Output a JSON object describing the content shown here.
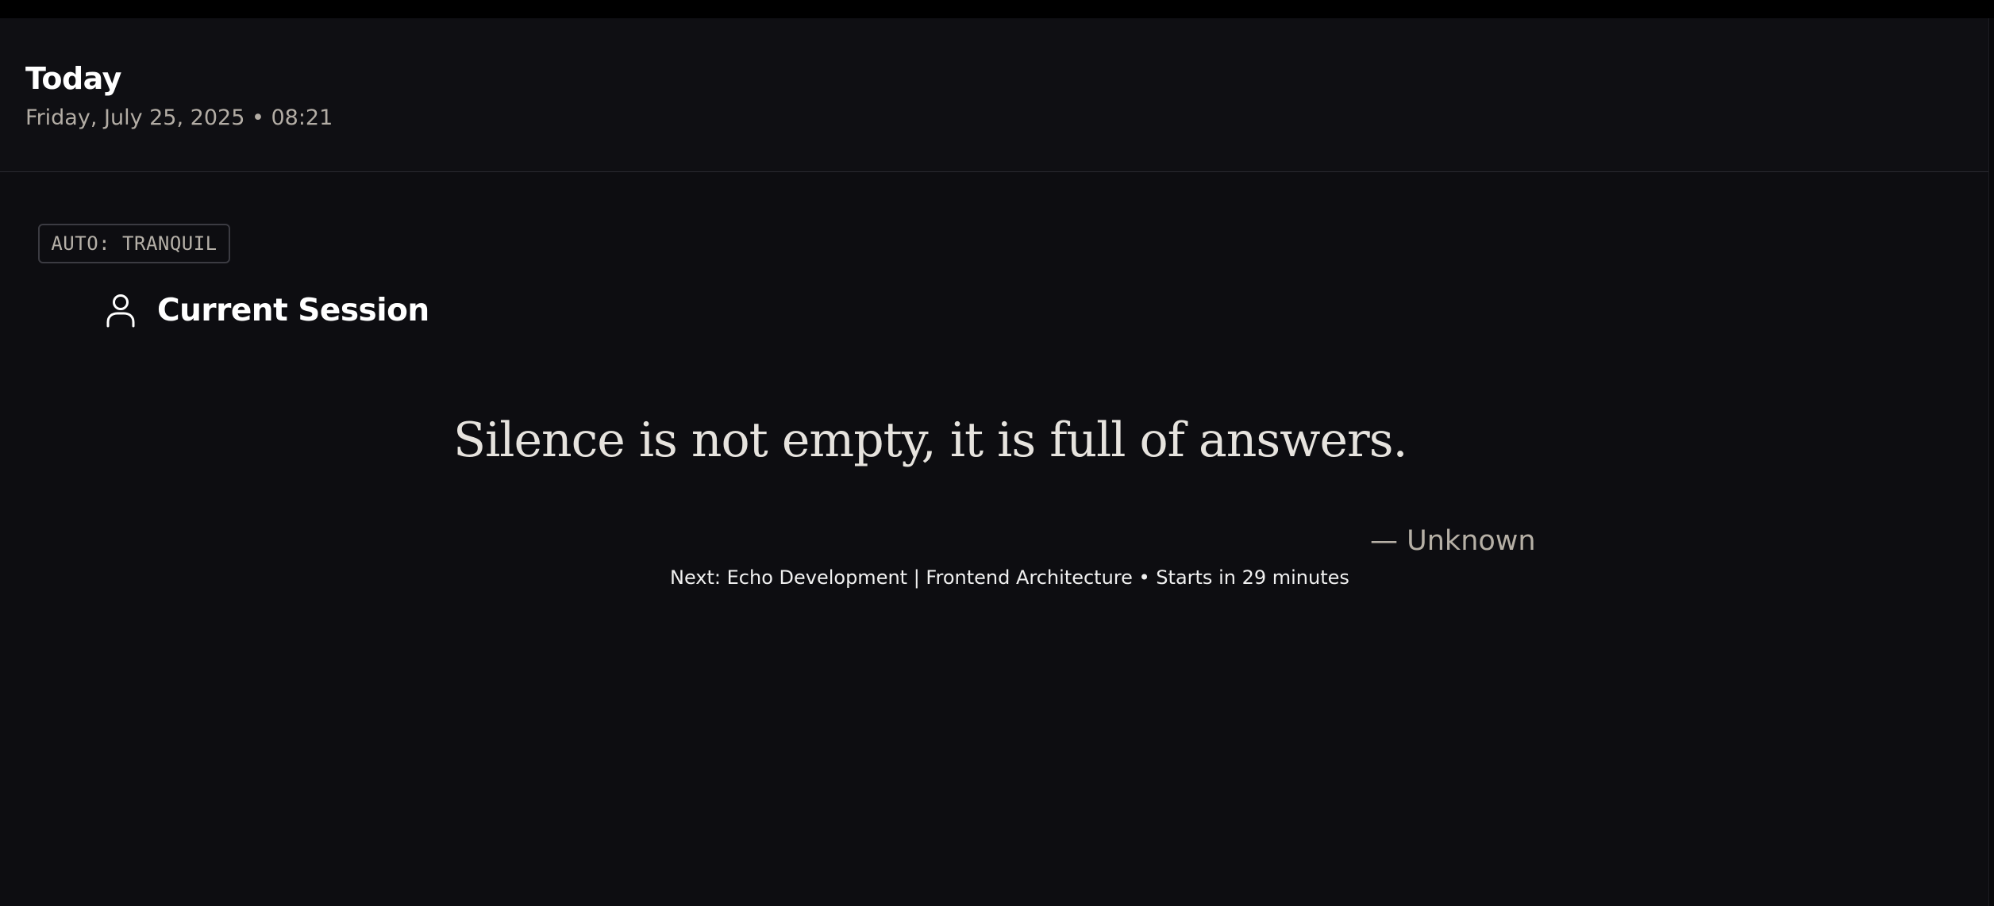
{
  "header": {
    "title": "Today",
    "subtitle": "Friday, July 25, 2025 • 08:21"
  },
  "mode_badge": {
    "label": "AUTO: TRANQUIL"
  },
  "session": {
    "icon": "person-icon",
    "title": "Current Session"
  },
  "quote": {
    "text": "Silence is not empty, it is full of answers.",
    "author": "— Unknown"
  },
  "next_event": {
    "text": "Next: Echo Development | Frontend Architecture • Starts in 29 minutes"
  },
  "colors": {
    "background": "#0d0d11",
    "header_background": "#0f0f13",
    "muted_text": "#b3ada5",
    "quote_text": "#e6e3de"
  }
}
